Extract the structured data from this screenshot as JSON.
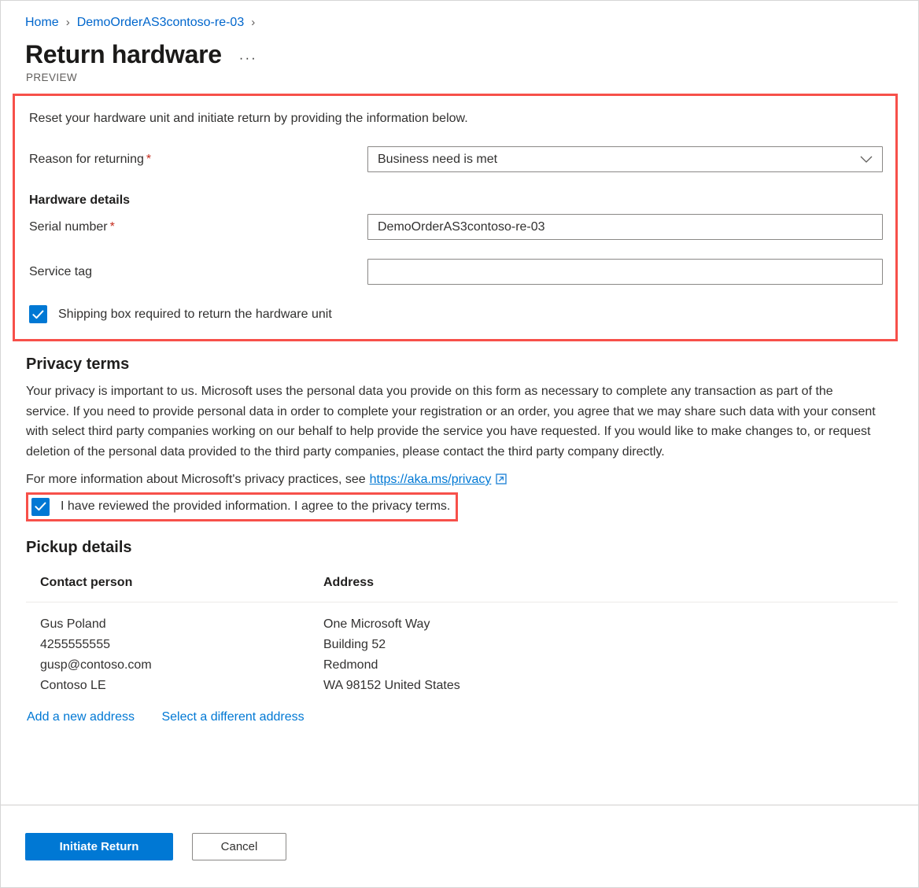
{
  "breadcrumb": {
    "items": [
      {
        "label": "Home"
      },
      {
        "label": "DemoOrderAS3contoso-re-03"
      }
    ],
    "separator": "›"
  },
  "header": {
    "title": "Return hardware",
    "overflow_menu": "···",
    "preview_tag": "PREVIEW"
  },
  "form": {
    "intro": "Reset your hardware unit and initiate return by providing the information below.",
    "reason_label": "Reason for returning",
    "required_marker": "*",
    "reason_value": "Business need is met",
    "hardware_details_heading": "Hardware details",
    "serial_label": "Serial number",
    "serial_value": "DemoOrderAS3contoso-re-03",
    "service_tag_label": "Service tag",
    "service_tag_value": "",
    "service_tag_placeholder": "",
    "shipping_box_label": "Shipping box required to return the hardware unit"
  },
  "privacy": {
    "heading": "Privacy terms",
    "paragraph": "Your privacy is important to us. Microsoft uses the personal data you provide on this form as necessary to complete any transaction as part of the service. If you need to provide personal data in order to complete your registration or an order, you agree that we may share such data with your consent with select third party companies working on our behalf to help provide the service you have requested. If you would like to make changes to, or request deletion of the personal data provided to the third party companies, please contact the third party company directly.",
    "more_info_prefix": "For more information about Microsoft's privacy practices, see",
    "link_text": "https://aka.ms/privacy",
    "consent_label": "I have reviewed the provided information. I agree to the privacy terms."
  },
  "pickup": {
    "heading": "Pickup details",
    "columns": [
      "Contact person",
      "Address"
    ],
    "contact": {
      "name": "Gus Poland",
      "phone": "4255555555",
      "email": "gusp@contoso.com",
      "company": "Contoso LE"
    },
    "address": {
      "line1": "One Microsoft Way",
      "line2": "Building 52",
      "city": "Redmond",
      "region": "WA 98152 United States"
    },
    "add_address_link": "Add a new address",
    "select_address_link": "Select a different address"
  },
  "footer": {
    "primary_button": "Initiate Return",
    "cancel_button": "Cancel"
  },
  "colors": {
    "accent": "#0078d4",
    "link": "#0066cc",
    "highlight": "#f7504a",
    "required": "#c42b1c"
  }
}
